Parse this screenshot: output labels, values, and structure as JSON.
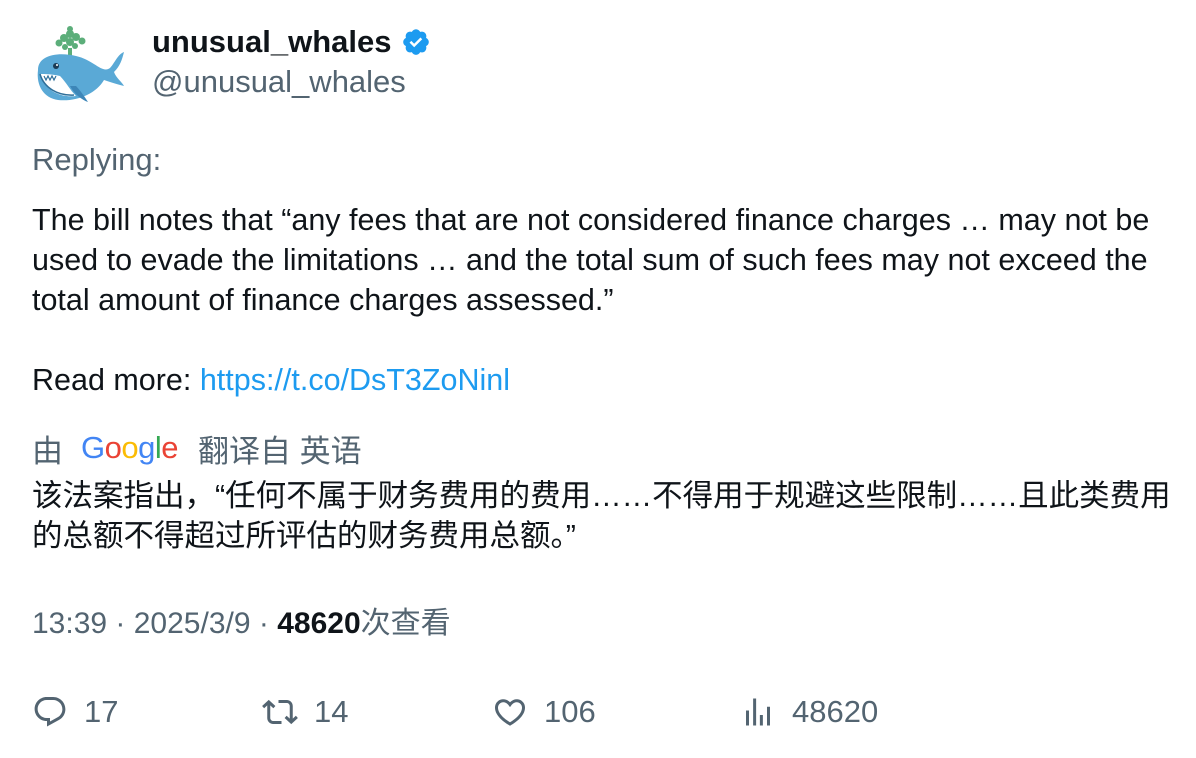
{
  "author": {
    "display_name": "unusual_whales",
    "handle": "@unusual_whales",
    "verified": true,
    "avatar_icon": "whale-logo",
    "verified_color": "#1d9bf0"
  },
  "reply_label": "Replying:",
  "tweet": {
    "line1": "The bill notes that “any fees that are not considered finance charges … may not be used to evade the limitations … and the total sum of such fees may not exceed the total amount of finance charges assessed.”",
    "read_more_label": "Read more: ",
    "link": "https://t.co/DsT3ZoNinl"
  },
  "translation": {
    "by_label": "由",
    "provider": "Google",
    "from_label": "翻译自 英语",
    "text": "该法案指出，“任何不属于财务费用的费用……不得用于规避这些限制……且此类费用的总额不得超过所评估的财务费用总额。”"
  },
  "meta": {
    "time": "13:39",
    "date": "2025/3/9",
    "views": "48620",
    "views_label": "次查看",
    "separator": " · "
  },
  "actions": {
    "replies": "17",
    "retweets": "14",
    "likes": "106",
    "views": "48620"
  },
  "colors": {
    "text": "#0f1419",
    "secondary": "#536471",
    "link": "#1d9bf0"
  }
}
